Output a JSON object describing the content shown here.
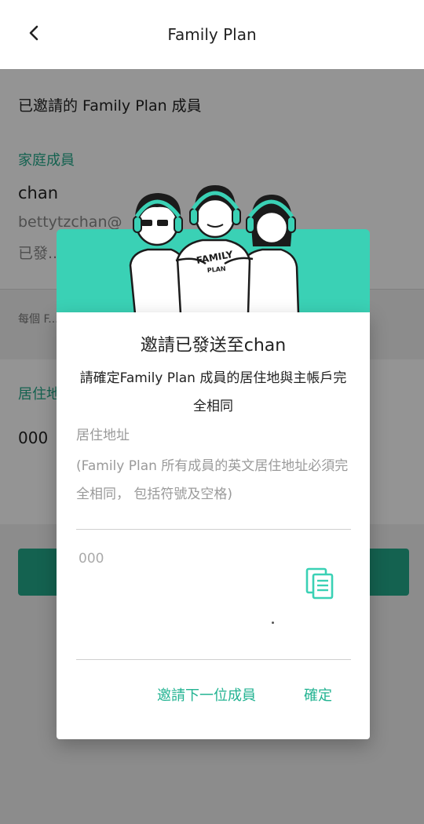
{
  "header": {
    "title": "Family Plan",
    "back_icon": "chevron-left-icon"
  },
  "background": {
    "section_title": "已邀請的 Family Plan 成員",
    "family_label": "家庭成員",
    "member": {
      "name": "chan",
      "email": "bettytzchan@",
      "status": "已發..."
    },
    "note": "每個 F...",
    "address_label": "居住地...",
    "address_value": "000"
  },
  "dialog": {
    "banner_text": "FAMILY PLAN",
    "title": "邀請已發送至chan",
    "subtitle": "請確定Family Plan 成員的居住地與主帳戶完全相同",
    "field_label": "居住地址",
    "field_hint": "(Family Plan 所有成員的英文居住地址必須完全相同， 包括符號及空格)",
    "field_value": "000",
    "copy_icon": "copy-document-icon",
    "buttons": {
      "invite_next": "邀請下一位成員",
      "confirm": "確定"
    }
  },
  "colors": {
    "accent": "#23a98b",
    "banner": "#3ad1b5",
    "action_text": "#23b392"
  }
}
